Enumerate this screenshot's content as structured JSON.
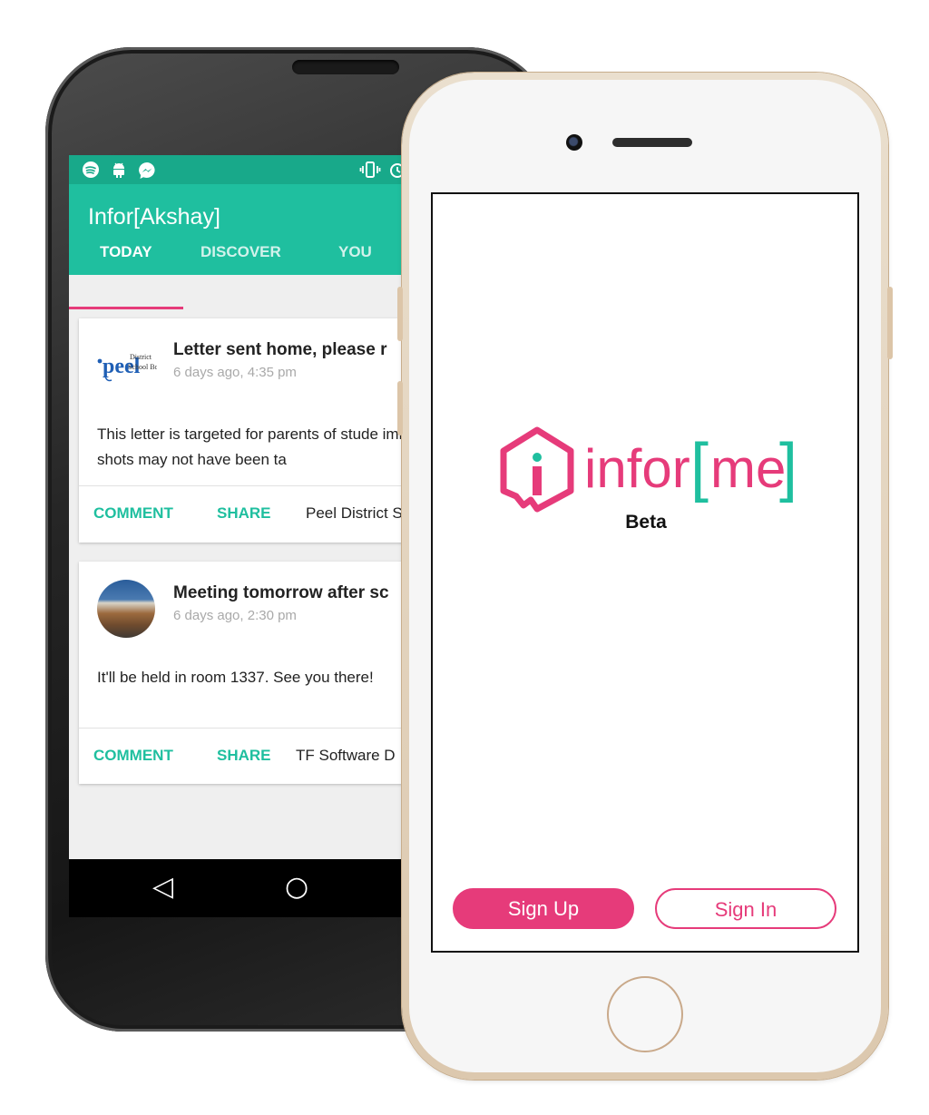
{
  "android": {
    "status_icons": [
      "spotify-icon",
      "android-icon",
      "messenger-icon",
      "vibrate-icon",
      "alarm-icon"
    ],
    "app_title": "Infor[Akshay]",
    "tabs": [
      {
        "label": "TODAY",
        "active": true
      },
      {
        "label": "DISCOVER",
        "active": false
      },
      {
        "label": "YOU",
        "active": false
      }
    ],
    "cards": [
      {
        "title": "Letter sent home, please r",
        "time": "6 days ago, 4:35 pm",
        "body": "This letter is targeted for parents of stude immunisation shots may not have been ta",
        "comment": "COMMENT",
        "share": "SHARE",
        "source": "Peel District S",
        "logo_text": "peel",
        "logo_sub1": "District",
        "logo_sub2": "School Board"
      },
      {
        "title": "Meeting tomorrow after sc",
        "time": "6 days ago, 2:30 pm",
        "body": "It'll be held in room 1337. See you there!",
        "comment": "COMMENT",
        "share": "SHARE",
        "source": "TF Software D"
      }
    ],
    "nav": {
      "back": "◁",
      "home": "○"
    },
    "colors": {
      "primary": "#1fbf9f",
      "status": "#18a98a",
      "accent": "#e63b7a"
    }
  },
  "iphone": {
    "logo_prefix": "infor",
    "logo_open": "[",
    "logo_me": "me",
    "logo_close": "]",
    "beta": "Beta",
    "signup": "Sign Up",
    "signin": "Sign In",
    "colors": {
      "brand_pink": "#e63b7a",
      "brand_teal": "#1fbf9f"
    }
  }
}
